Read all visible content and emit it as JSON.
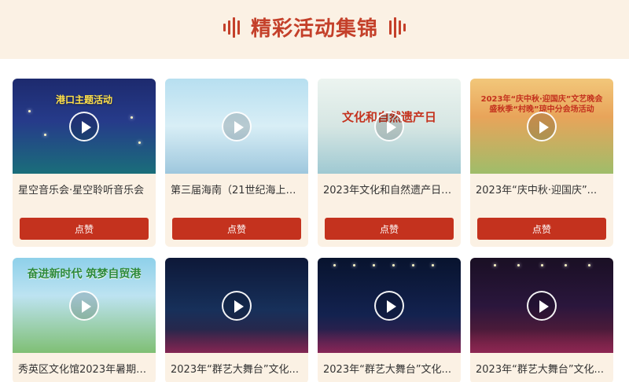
{
  "header": {
    "title": "精彩活动集锦"
  },
  "cards": [
    {
      "title": "星空音乐会·星空聆听音乐会",
      "thumb_text": "港口主题活动",
      "like_label": "点赞"
    },
    {
      "title": "第三届海南（21世纪海上丝路...",
      "thumb_text": "",
      "like_label": "点赞"
    },
    {
      "title": "2023年文化和自然遗产日之...",
      "thumb_text": "文化和自然遗产日",
      "like_label": "点赞"
    },
    {
      "title": "2023年“庆中秋·迎国庆”...",
      "thumb_text": "2023年“庆中秋·迎国庆”文艺晚会\n盛秋季“村晚”琼中分会场活动",
      "like_label": "点赞"
    },
    {
      "title": "秀英区文化馆2023年暑期免...",
      "thumb_text": "奋进新时代 筑梦自贸港",
      "like_label": ""
    },
    {
      "title": "2023年“群艺大舞台”文化...",
      "thumb_text": "",
      "like_label": ""
    },
    {
      "title": "2023年“群艺大舞台”文化...",
      "thumb_text": "",
      "like_label": ""
    },
    {
      "title": "2023年“群艺大舞台”文化...",
      "thumb_text": "",
      "like_label": ""
    }
  ],
  "colors": {
    "accent": "#c4402a",
    "button": "#c4321e",
    "card_bg": "#fbf1e4"
  }
}
